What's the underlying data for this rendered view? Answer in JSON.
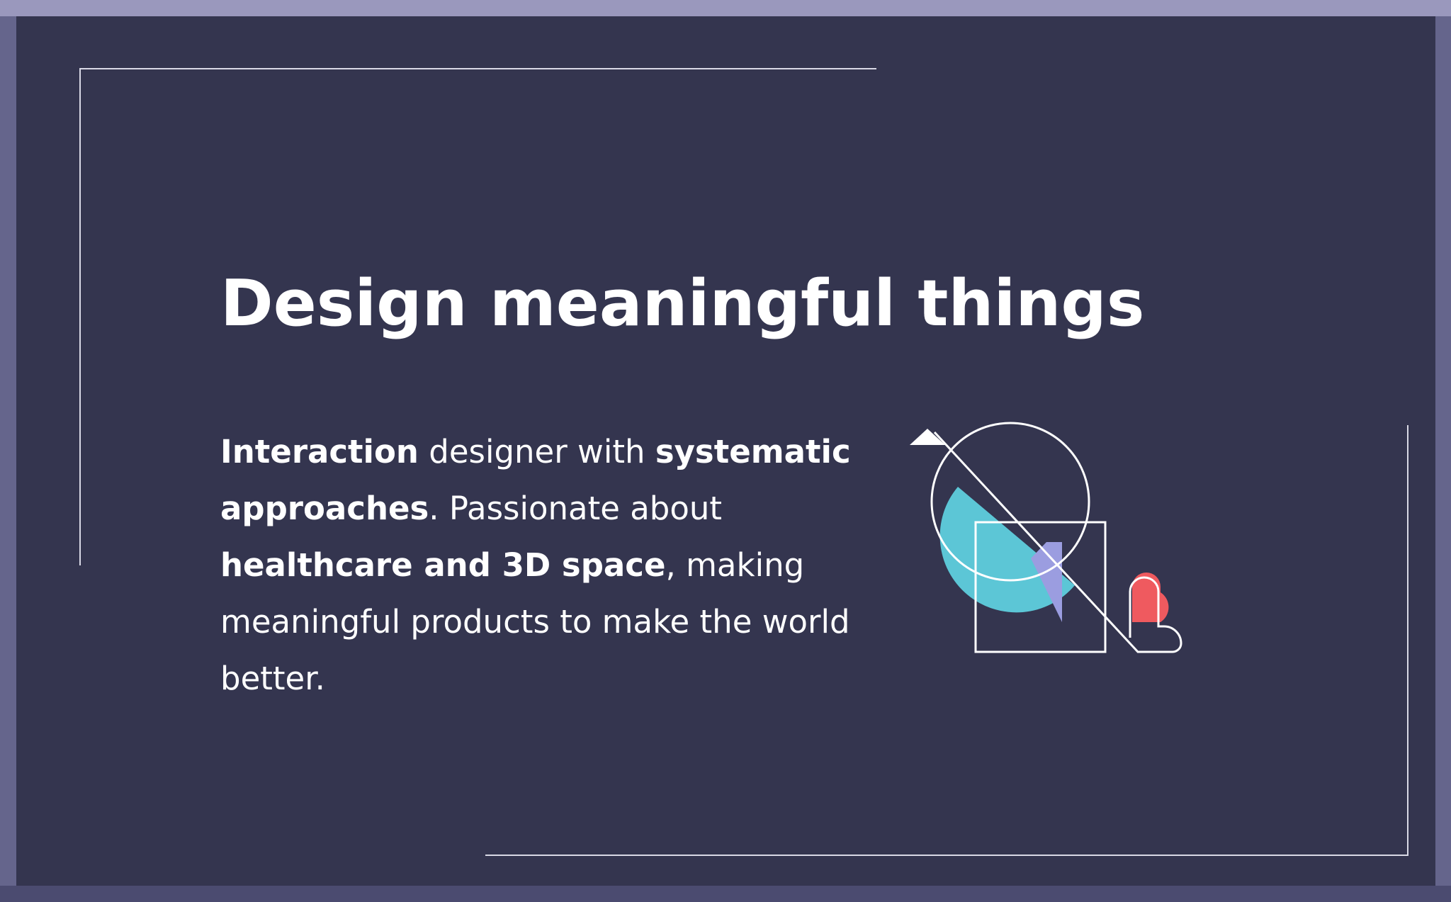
{
  "slide": {
    "title": "Design meaningful things",
    "intro": {
      "p1_bold_initial": "I",
      "p1_bold_rest": "nteraction",
      "p2": " designer with ",
      "p3_bold": "systematic approaches",
      "p4": ". Passionate about ",
      "p5_bold": "healthcare and 3D space",
      "p6": ", making meaningful products to make the world better."
    }
  },
  "colors": {
    "card_background": "#34354f",
    "outer_border": "#65658c",
    "top_strip": "#9a98bd",
    "bottom_strip": "#4b4b70",
    "accent_cyan": "#5cc6d6",
    "accent_lavender": "#9b9de0",
    "accent_red": "#ef5a5f",
    "line_white": "#ffffff"
  },
  "icons": {
    "illustration": "geometric-shapes-with-heart-icon"
  }
}
